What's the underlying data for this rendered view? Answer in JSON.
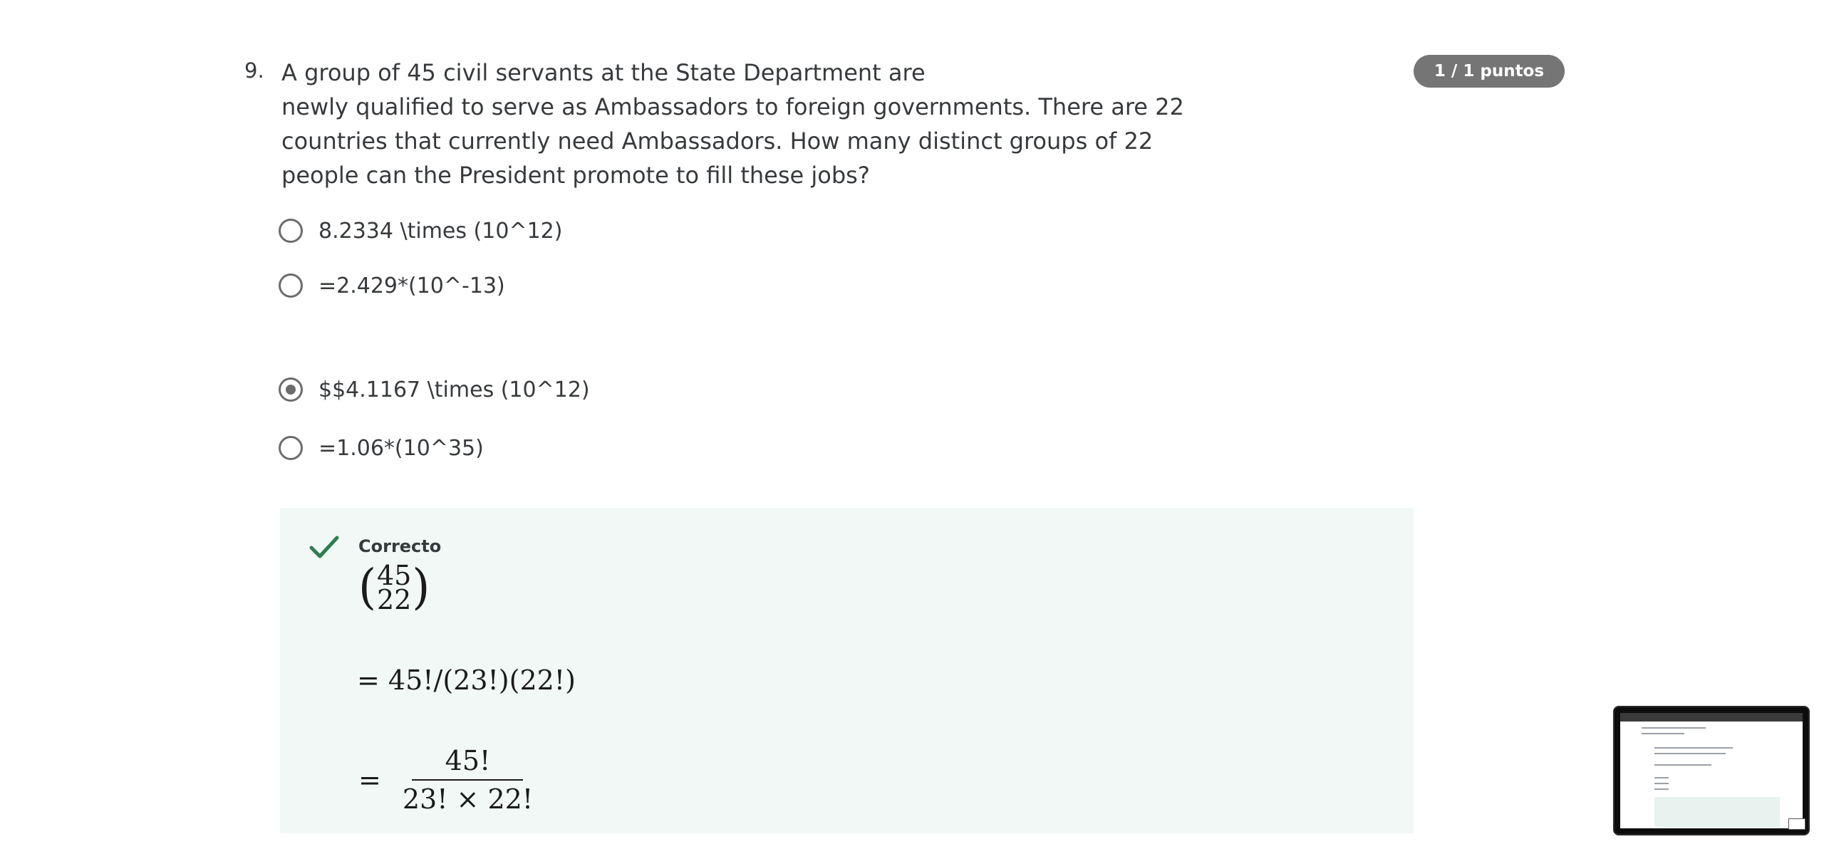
{
  "question": {
    "number": "9.",
    "text_lines": [
      "A group of 45 civil servants at the State Department are",
      "newly qualified to serve as Ambassadors to foreign governments. There are 22",
      "countries that currently need Ambassadors. How many distinct groups of 22",
      "people can the President promote to fill these jobs?"
    ],
    "score": "1 / 1 puntos"
  },
  "options": [
    {
      "label": "8.2334 \\times (10^12)",
      "selected": false
    },
    {
      "label": "=2.429*(10^-13)",
      "selected": false
    },
    {
      "label": "$$4.1167 \\times (10^12)",
      "selected": true
    },
    {
      "label": "=1.06*(10^35)",
      "selected": false
    }
  ],
  "feedback": {
    "status": "Correcto",
    "icon": "checkmark-icon",
    "accent_color": "#2e7d4f",
    "background_color": "#f2f8f6",
    "binom_top": "45",
    "binom_bottom": "22",
    "line2": "= 45!/(23!)(22!)",
    "line3_eq": "=",
    "line3_num": "45!",
    "line3_den": "23! × 22!"
  },
  "thumbnail": {
    "icon": "screen-preview-thumbnail"
  }
}
